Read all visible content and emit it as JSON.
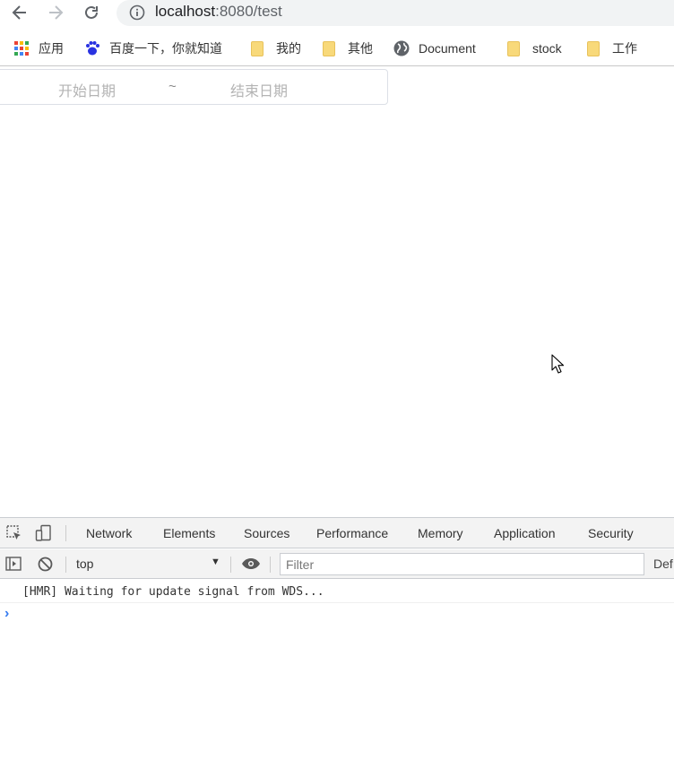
{
  "browser": {
    "url_host": "localhost",
    "url_rest": ":8080/test"
  },
  "bookmarks": [
    {
      "label": "应用",
      "icon": "apps-grid-icon"
    },
    {
      "label": "百度一下，你就知道",
      "icon": "baidu-paw-icon"
    },
    {
      "label": "我的",
      "icon": "folder-icon"
    },
    {
      "label": "其他",
      "icon": "folder-icon"
    },
    {
      "label": "Document",
      "icon": "globe-icon"
    },
    {
      "label": "stock",
      "icon": "folder-icon"
    },
    {
      "label": "工作",
      "icon": "folder-icon"
    }
  ],
  "date_range": {
    "start_placeholder": "开始日期",
    "separator": "~",
    "end_placeholder": "结束日期"
  },
  "devtools": {
    "tabs": [
      "Network",
      "Elements",
      "Sources",
      "Performance",
      "Memory",
      "Application",
      "Security"
    ],
    "context": "top",
    "filter_placeholder": "Filter",
    "levels_label": "Def",
    "console_messages": [
      "[HMR] Waiting for update signal from WDS..."
    ],
    "prompt_symbol": "›"
  }
}
